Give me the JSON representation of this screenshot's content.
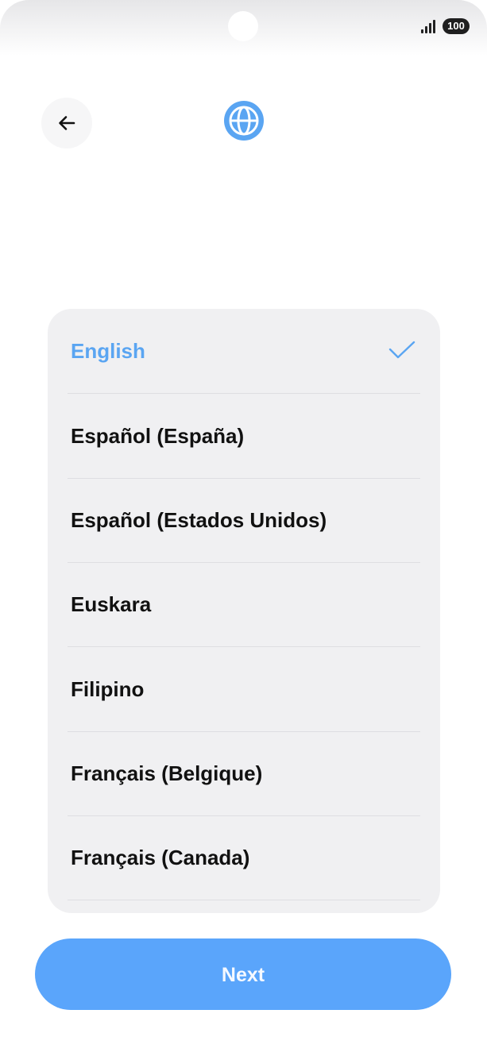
{
  "status_bar": {
    "battery_level": "100",
    "signal_icon": "signal-bars-icon"
  },
  "header": {
    "back_icon": "arrow-left-icon",
    "globe_icon": "globe-icon",
    "accent_color": "#5aa5f2"
  },
  "languages": [
    {
      "label": "English",
      "selected": true
    },
    {
      "label": "Español (España)",
      "selected": false
    },
    {
      "label": "Español (Estados Unidos)",
      "selected": false
    },
    {
      "label": "Euskara",
      "selected": false
    },
    {
      "label": "Filipino",
      "selected": false
    },
    {
      "label": "Français (Belgique)",
      "selected": false
    },
    {
      "label": "Français (Canada)",
      "selected": false
    }
  ],
  "selected_icon": "checkmark-icon",
  "next_button": {
    "label": "Next",
    "color": "#5aa5fb"
  }
}
